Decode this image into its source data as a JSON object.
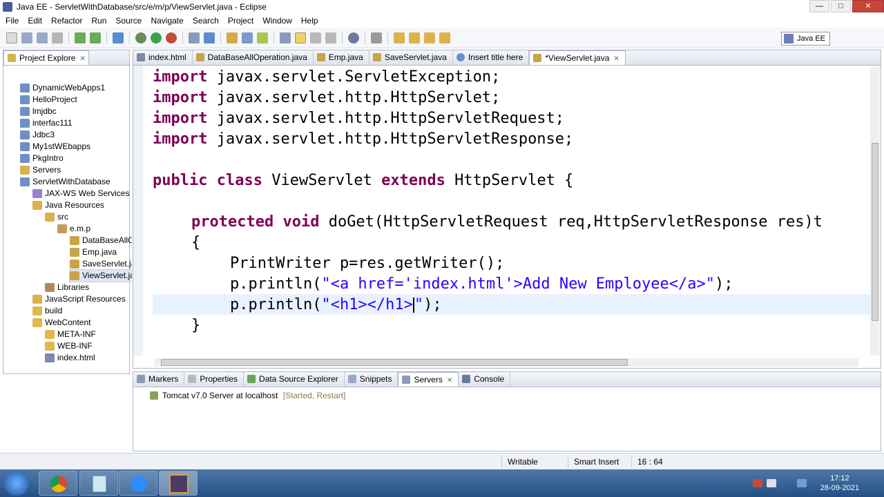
{
  "window": {
    "title": "Java EE - ServletWithDatabase/src/e/m/p/ViewServlet.java - Eclipse"
  },
  "menu": [
    "File",
    "Edit",
    "Refactor",
    "Run",
    "Source",
    "Navigate",
    "Search",
    "Project",
    "Window",
    "Help"
  ],
  "perspective": "Java EE",
  "project_explorer": {
    "tab_label": "Project Explore",
    "items": [
      {
        "label": "DynamicWebApps1",
        "color": "#6f8fc7"
      },
      {
        "label": "HelloProject",
        "color": "#6f8fc7"
      },
      {
        "label": "lmjdbc",
        "color": "#6f8fc7"
      },
      {
        "label": "interfac111",
        "color": "#6f8fc7"
      },
      {
        "label": "Jdbc3",
        "color": "#6f8fc7"
      },
      {
        "label": "My1stWEbapps",
        "color": "#6f8fc7"
      },
      {
        "label": "PkgIntro",
        "color": "#6f8fc7"
      },
      {
        "label": "Servers",
        "color": "#d8b24e"
      },
      {
        "label": "ServletWithDatabase",
        "color": "#6f8fc7"
      },
      {
        "label": "JAX-WS Web Services",
        "color": "#9b7fcf"
      },
      {
        "label": "Java Resources",
        "color": "#d8b24e"
      },
      {
        "label": "src",
        "color": "#d8b24e"
      },
      {
        "label": "e.m.p",
        "color": "#c89a5a"
      },
      {
        "label": "DataBaseAllO",
        "color": "#c8a34a"
      },
      {
        "label": "Emp.java",
        "color": "#c8a34a"
      },
      {
        "label": "SaveServlet.ja",
        "color": "#c8a34a"
      },
      {
        "label": "ViewServlet.ja",
        "color": "#c8a34a"
      },
      {
        "label": "Libraries",
        "color": "#b28a5a"
      },
      {
        "label": "JavaScript Resources",
        "color": "#d8b24e"
      },
      {
        "label": "build",
        "color": "#e0b84c"
      },
      {
        "label": "WebContent",
        "color": "#e0b84c"
      },
      {
        "label": "META-INF",
        "color": "#e0b84c"
      },
      {
        "label": "WEB-INF",
        "color": "#e0b84c"
      },
      {
        "label": "index.html",
        "color": "#7a8aa8"
      }
    ]
  },
  "editor_tabs": [
    {
      "label": "index.html",
      "color": "#7a8aa8"
    },
    {
      "label": "DataBaseAllOperation.java",
      "color": "#c8a34a"
    },
    {
      "label": "Emp.java",
      "color": "#c8a34a"
    },
    {
      "label": "SaveServlet.java",
      "color": "#c8a34a"
    },
    {
      "label": "Insert title here",
      "color": "#6b8fd4"
    },
    {
      "label": "*ViewServlet.java",
      "color": "#c8a34a"
    }
  ],
  "code": {
    "l1_kw": "import",
    "l1_rest": " javax.servlet.ServletException;",
    "l2_kw": "import",
    "l2_rest": " javax.servlet.http.HttpServlet;",
    "l3_kw": "import",
    "l3_rest": " javax.servlet.http.HttpServletRequest;",
    "l4_kw": "import",
    "l4_rest": " javax.servlet.http.HttpServletResponse;",
    "l5_kw1": "public",
    "l5_kw2": "class",
    "l5_mid": " ViewServlet ",
    "l5_kw3": "extends",
    "l5_rest": " HttpServlet {",
    "l6_kw1": "protected",
    "l6_kw2": "void",
    "l6_rest": " doGet(HttpServletRequest req,HttpServletResponse res)t",
    "l7": "{",
    "l8": "PrintWriter p=res.getWriter();",
    "l9_a": "p.println(",
    "l9_str": "\"<a href='index.html'>Add New Employee</a>\"",
    "l9_b": ");",
    "l10_a": "p.println(",
    "l10_str": "\"<h1></h1>",
    "l10_str2": "\"",
    "l10_b": ");",
    "l11": "}"
  },
  "bottom_tabs": [
    "Markers",
    "Properties",
    "Data Source Explorer",
    "Snippets",
    "Servers",
    "Console"
  ],
  "server": {
    "name": "Tomcat v7.0 Server at localhost",
    "state": "[Started, Restart]"
  },
  "status": {
    "writable": "Writable",
    "insert_mode": "Smart Insert",
    "position": "16 : 64"
  },
  "clock": {
    "time": "17:12",
    "date": "28-09-2021"
  }
}
